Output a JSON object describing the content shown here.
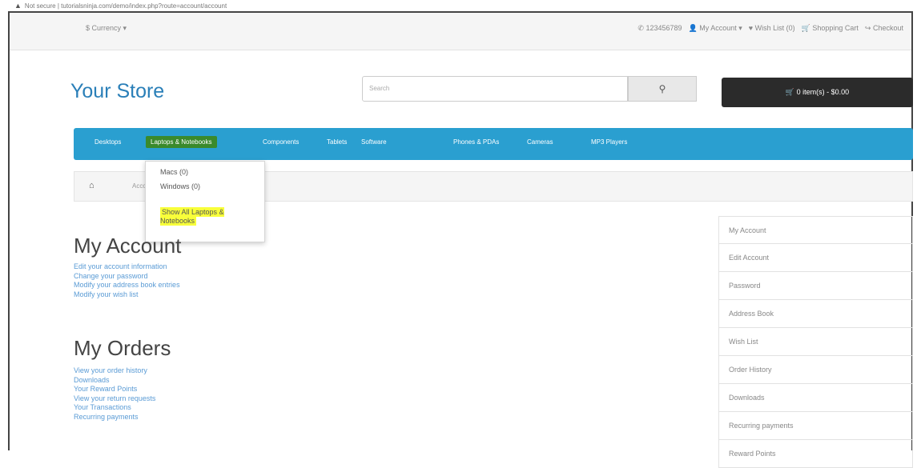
{
  "address_bar": {
    "security": "Not secure",
    "url": "tutorialsninja.com/demo/index.php?route=account/account"
  },
  "topbar": {
    "currency": "$ Currency",
    "links": [
      "123456789",
      "My Account",
      "Wish List (0)",
      "Shopping Cart",
      "Checkout"
    ]
  },
  "header": {
    "logo": "Your Store",
    "search_placeholder": "Search",
    "cart": "0 item(s) - $0.00"
  },
  "menu": [
    "Desktops",
    "Laptops & Notebooks",
    "Components",
    "Tablets",
    "Software",
    "Phones & PDAs",
    "Cameras",
    "MP3 Players"
  ],
  "dropdown": {
    "items": [
      "Macs (0)",
      "Windows (0)"
    ],
    "show_all": "Show All Laptops & Notebooks"
  },
  "breadcrumb": {
    "crumb": "Account"
  },
  "account": {
    "title": "My Account",
    "links": [
      "Edit your account information",
      "Change your password",
      "Modify your address book entries",
      "Modify your wish list"
    ]
  },
  "orders": {
    "title": "My Orders",
    "links": [
      "View your order history",
      "Downloads",
      "Your Reward Points",
      "View your return requests",
      "Your Transactions",
      "Recurring payments"
    ]
  },
  "sidebar": [
    "My Account",
    "Edit Account",
    "Password",
    "Address Book",
    "Wish List",
    "Order History",
    "Downloads",
    "Recurring payments",
    "Reward Points"
  ]
}
